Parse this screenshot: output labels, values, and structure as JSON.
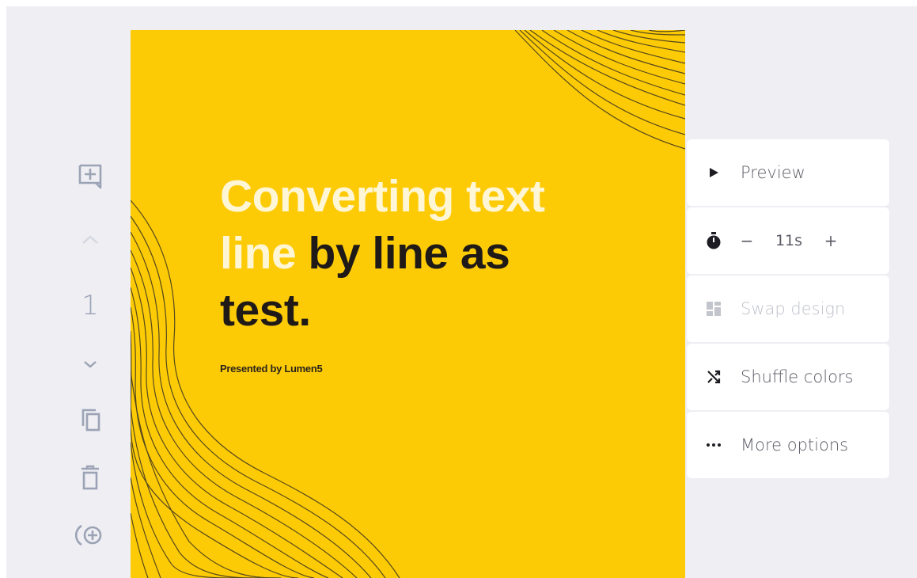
{
  "toolbar": {
    "slide_number": "1",
    "icons": [
      "add-text-icon",
      "chevron-up-icon",
      "chevron-down-icon",
      "duplicate-icon",
      "delete-icon",
      "add-audio-icon"
    ]
  },
  "slide": {
    "background_color": "#fdcb06",
    "headline_highlight_1": "Converting text",
    "headline_highlight_2": "line",
    "headline_rest_2": "by line as",
    "headline_line_3": "test.",
    "byline": "Presented by Lumen5"
  },
  "panel": {
    "preview_label": "Preview",
    "duration_decrease": "−",
    "duration_value": "11s",
    "duration_increase": "+",
    "swap_design_label": "Swap design",
    "shuffle_colors_label": "Shuffle colors",
    "more_options_label": "More options"
  },
  "colors": {
    "canvas_bg": "#eeeef3",
    "toolbar_icon": "#9ba3b5",
    "headline_highlight": "#fff6d6",
    "headline_text": "#1f1a17"
  }
}
